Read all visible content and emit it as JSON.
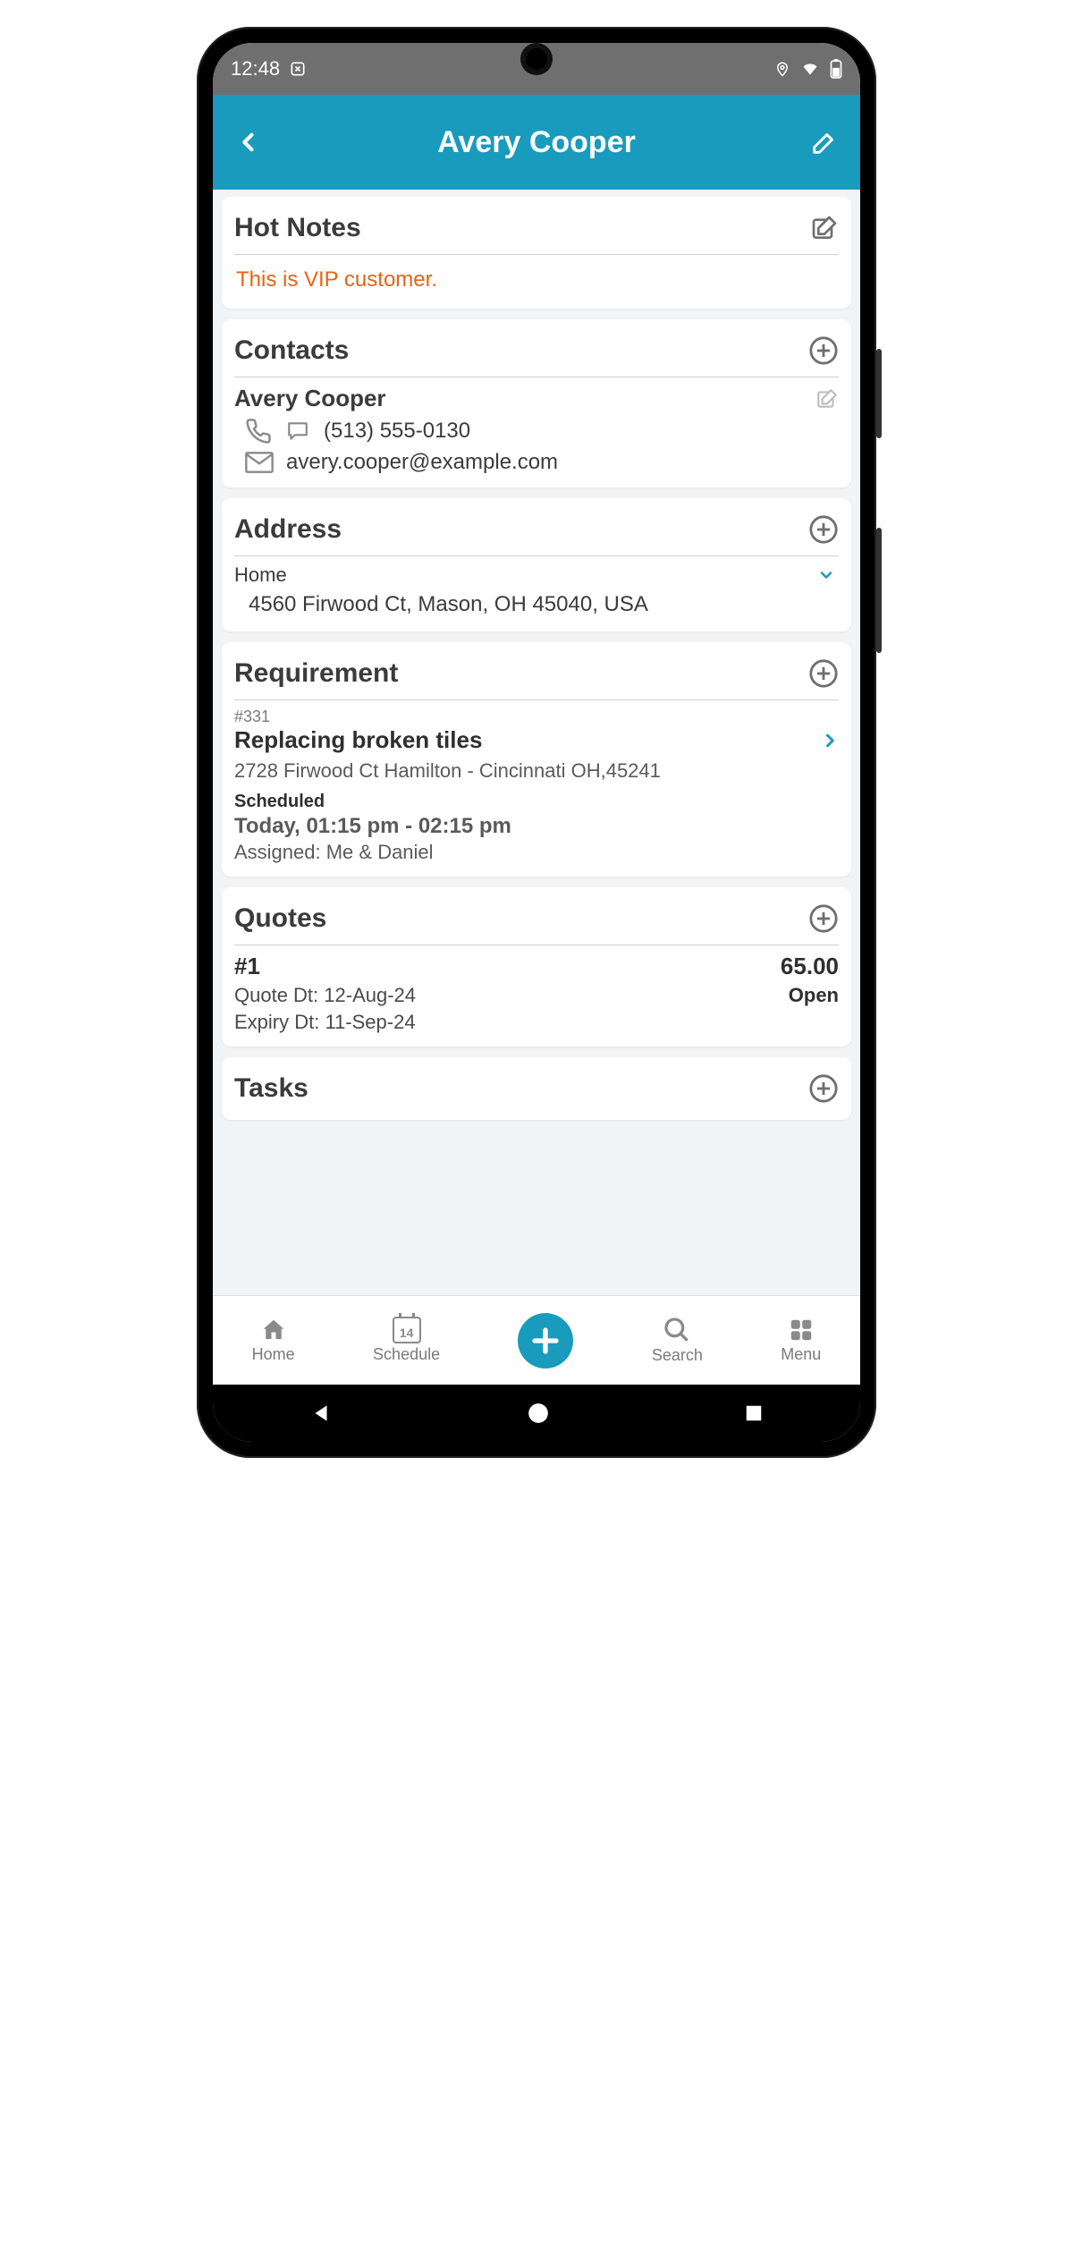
{
  "statusbar": {
    "time": "12:48"
  },
  "header": {
    "title": "Avery Cooper"
  },
  "hotnotes": {
    "title": "Hot Notes",
    "text": "This is VIP customer."
  },
  "contacts": {
    "title": "Contacts",
    "name": "Avery Cooper",
    "phone": "(513) 555-0130",
    "email": "avery.cooper@example.com"
  },
  "address": {
    "title": "Address",
    "label": "Home",
    "text": "4560 Firwood Ct, Mason, OH 45040, USA"
  },
  "requirement": {
    "title": "Requirement",
    "num": "#331",
    "name": "Replacing broken tiles",
    "addr": "2728 Firwood Ct Hamilton - Cincinnati OH,45241",
    "status": "Scheduled",
    "time": "Today, 01:15 pm - 02:15 pm",
    "assigned": "Assigned: Me & Daniel"
  },
  "quotes": {
    "title": "Quotes",
    "id": "#1",
    "amount": "65.00",
    "date_label": "Quote Dt: 12-Aug-24",
    "status": "Open",
    "expiry_label": "Expiry Dt: 11-Sep-24"
  },
  "tasks": {
    "title": "Tasks"
  },
  "tabs": {
    "home": "Home",
    "schedule": "Schedule",
    "schedule_day": "14",
    "search": "Search",
    "menu": "Menu"
  }
}
